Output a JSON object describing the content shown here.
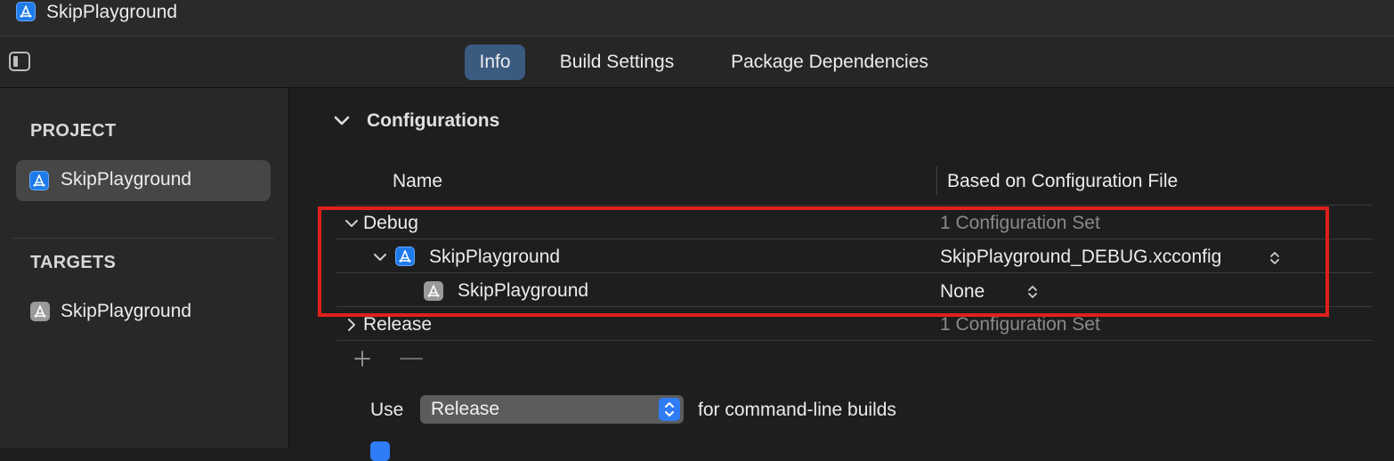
{
  "window": {
    "title": "SkipPlayground"
  },
  "tabs": [
    {
      "label": "Info",
      "selected": true
    },
    {
      "label": "Build Settings",
      "selected": false
    },
    {
      "label": "Package Dependencies",
      "selected": false
    }
  ],
  "sidebar": {
    "project_heading": "PROJECT",
    "project_item": "SkipPlayground",
    "targets_heading": "TARGETS",
    "target_item": "SkipPlayground"
  },
  "configurations": {
    "title": "Configurations",
    "columns": {
      "name": "Name",
      "based_on": "Based on Configuration File"
    },
    "debug": {
      "label": "Debug",
      "summary": "1 Configuration Set",
      "project_row": {
        "name": "SkipPlayground",
        "file": "SkipPlayground_DEBUG.xcconfig"
      },
      "target_row": {
        "name": "SkipPlayground",
        "file": "None"
      }
    },
    "release": {
      "label": "Release",
      "summary": "1 Configuration Set"
    }
  },
  "command_line": {
    "use_label": "Use",
    "selected": "Release",
    "suffix": "for command-line builds"
  },
  "colors": {
    "accent": "#2f7cf6",
    "selected_tab": "#3a5a80",
    "highlight_box": "#e0201c",
    "background": "#1e1e1e"
  }
}
